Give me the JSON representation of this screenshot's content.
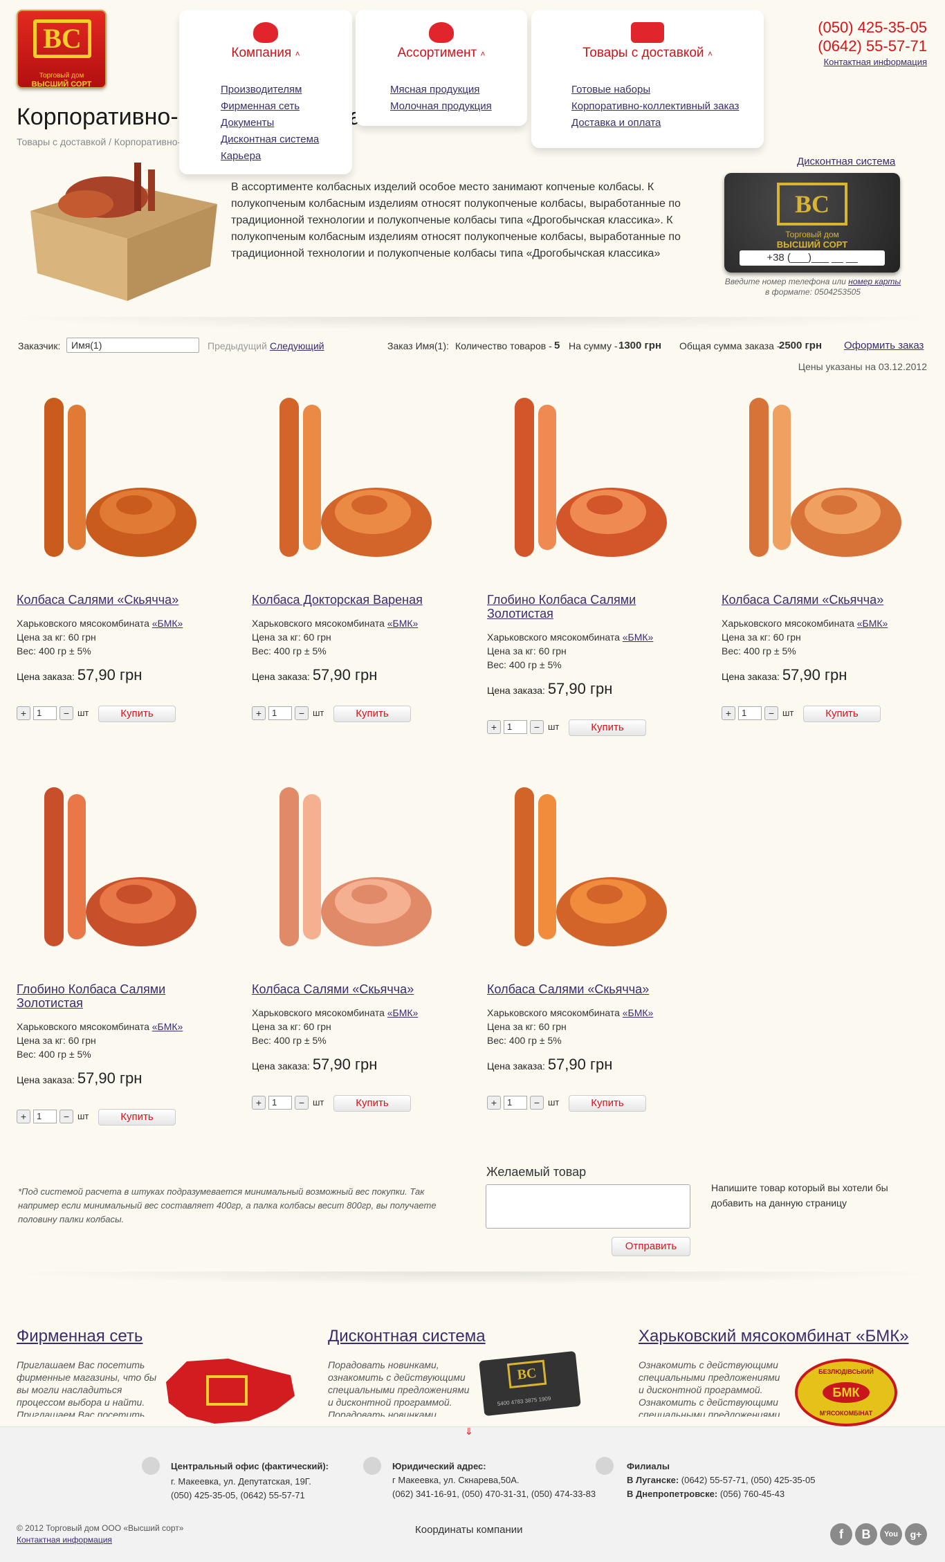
{
  "logo": {
    "mark": "ВС",
    "line1": "Торговый дом",
    "line2": "ВЫСШИЙ СОРТ"
  },
  "nav": [
    {
      "title": "Компания",
      "items": [
        "Производителям",
        "Фирменная сеть",
        "Документы",
        "Дисконтная система",
        "Карьера"
      ]
    },
    {
      "title": "Ассортимент",
      "items": [
        "Мясная продукция",
        "Молочная продукция"
      ]
    },
    {
      "title": "Товары с доставкой",
      "items": [
        "Готовые наборы",
        "Корпоративно-коллективный заказ",
        "Доставка и оплата"
      ]
    }
  ],
  "phones": {
    "p1": "(050) 425-35-05",
    "p2": "(0642) 55-57-71",
    "contact": "Контактная информация"
  },
  "page": {
    "title": "Корпоративно-коллективный заказ",
    "breadcrumb": "Товары с доставкой / Корпоративно-коллективный заказ"
  },
  "intro": {
    "text": "В ассортименте колбасных изделий особое место занимают копченые колбасы. К полукопченым колбасным изделиям относят полукопченые колбасы, выработанные по традиционной технологии и полукопченые колбасы типа «Дрогобычская классика». К полукопченым колбасным изделиям относят полукопченые колбасы, выработанные по традиционной технологии и полукопченые колбасы типа «Дрогобычская классика»"
  },
  "discount": {
    "link": "Дисконтная система",
    "card_line1": "Торговый дом",
    "card_line2": "ВЫСШИЙ СОРТ",
    "phone_mask": "+38 (___)___ __ __",
    "hint1": "Введите номер телефона или ",
    "hint_link": "номер карты",
    "hint2": "в формате: 0504253505"
  },
  "order": {
    "customer_label": "Заказчик:",
    "customer_value": "Имя(1)",
    "prev": "Предыдущий",
    "next": "Следующий",
    "order_name": "Заказ Имя(1):",
    "count_label": "Количество товаров -",
    "count": "5",
    "sum_label": "На сумму -",
    "sum": "1300 грн",
    "total_label": "Общая сумма заказа -",
    "total": "2500 грн",
    "checkout": "Оформить заказ",
    "prices_date": "Цены указаны на 03.12.2012"
  },
  "products": [
    {
      "name": "Колбаса Салями «Скьяччa»",
      "origin": "Харьковского мясокомбината ",
      "brand": "«БМК»",
      "price_kg": "Цена за кг: 60 грн",
      "weight": "Вес: 400 гр ± 5%",
      "order_label": "Цена заказа:",
      "order_price": "57,90 грн",
      "qty": "1",
      "unit": "шт",
      "buy": "Купить",
      "colors": [
        "#c95b1c",
        "#e07a34"
      ]
    },
    {
      "name": "Колбаса Докторская Вареная",
      "origin": "Харьковского мясокомбината ",
      "brand": "«БМК»",
      "price_kg": "Цена за кг: 60 грн",
      "weight": "Вес: 400 гр ± 5%",
      "order_label": "Цена заказа:",
      "order_price": "57,90 грн",
      "qty": "1",
      "unit": "шт",
      "buy": "Купить",
      "colors": [
        "#d3642a",
        "#eb8a45"
      ]
    },
    {
      "name": "Глобино Колбаса Салями Золотистая",
      "origin": "Харьковского мясокомбината ",
      "brand": "«БМК»",
      "price_kg": "Цена за кг: 60 грн",
      "weight": "Вес: 400 гр ± 5%",
      "order_label": "Цена заказа:",
      "order_price": "57,90 грн",
      "qty": "1",
      "unit": "шт",
      "buy": "Купить",
      "colors": [
        "#d2562a",
        "#ef8a52"
      ]
    },
    {
      "name": "Колбаса Салями «Скьяччa»",
      "origin": "Харьковского мясокомбината ",
      "brand": "«БМК»",
      "price_kg": "Цена за кг: 60 грн",
      "weight": "Вес: 400 гр ± 5%",
      "order_label": "Цена заказа:",
      "order_price": "57,90 грн",
      "qty": "1",
      "unit": "шт",
      "buy": "Купить",
      "colors": [
        "#d77338",
        "#f0a060"
      ]
    },
    {
      "name": "Глобино Колбаса Салями Золотистая",
      "origin": "Харьковского мясокомбината ",
      "brand": "«БМК»",
      "price_kg": "Цена за кг: 60 грн",
      "weight": "Вес: 400 гр ± 5%",
      "order_label": "Цена заказа:",
      "order_price": "57,90 грн",
      "qty": "1",
      "unit": "шт",
      "buy": "Купить",
      "colors": [
        "#c7502a",
        "#e87848"
      ]
    },
    {
      "name": "Колбаса Салями «Скьяччa»",
      "origin": "Харьковского мясокомбината ",
      "brand": "«БМК»",
      "price_kg": "Цена за кг: 60 грн",
      "weight": "Вес: 400 гр ± 5%",
      "order_label": "Цена заказа:",
      "order_price": "57,90 грн",
      "qty": "1",
      "unit": "шт",
      "buy": "Купить",
      "colors": [
        "#e08a68",
        "#f4b090"
      ]
    },
    {
      "name": "Колбаса Салями «Скьяччa»",
      "origin": "Харьковского мясокомбината ",
      "brand": "«БМК»",
      "price_kg": "Цена за кг: 60 грн",
      "weight": "Вес: 400 гр ± 5%",
      "order_label": "Цена заказа:",
      "order_price": "57,90 грн",
      "qty": "1",
      "unit": "шт",
      "buy": "Купить",
      "colors": [
        "#d2642a",
        "#f08c3c"
      ]
    }
  ],
  "note": "*Под системой расчета в штуках подразумевается минимальный возможный вес покупки. Так например если минимальный вес составляет 400гр, а палка колбасы весит 800гр, вы получаете половину палки колбасы.",
  "wish": {
    "title": "Желаемый товар",
    "hint": "Напишите товар который вы хотели бы добавить  на данную страницу",
    "send": "Отправить"
  },
  "bottom": [
    {
      "title": "Фирменная сеть",
      "text": "Приглашаем Вас посетить фирменные магазины, что бы вы могли насладиться процессом выбора и найти. Приглашаем Вас посетить фирменные магазины"
    },
    {
      "title": "Дисконтная система",
      "text": "Порадовать новинками, ознакомить с действующими специальными предложениями и дисконтной программой. Порадовать новинками, ознакомить с действующими",
      "card_number": "5400 4783 3875 1909"
    },
    {
      "title": "Харьковский мясокомбинат «БМК»",
      "text": "Ознакомить с действующими специальными предложениями и дисконтной программой. Ознакомить с действующими специальными предложениями и дисконтной программой.",
      "seal_top": "БЕЗЛЮДІВСЬКИЙ",
      "seal_mid": "БМК",
      "seal_bottom": "М'ЯСОКОМБІНАТ"
    }
  ],
  "footer": {
    "office_title": "Центральный офис (фактический):",
    "office_l1": "г. Макеевка, ул. Депутатская, 19Г.",
    "office_l2": "(050) 425-35-05, (0642) 55-57-71",
    "legal_title": "Юридический адрес:",
    "legal_l1": "г Макеевка, ул. Скнарева,50А.",
    "legal_l2": "(062) 341-16-91, (050) 470-31-31, (050) 474-33-83",
    "branch_title": "Филиалы",
    "branch_l1_city": "В Луганске:",
    "branch_l1": " (0642) 55-57-71, (050) 425-35-05",
    "branch_l2_city": "В Днепропетровске:",
    "branch_l2": " (056) 760-45-43",
    "copyright": "© 2012 Торговый дом ООО «Высший сорт»",
    "contact": "Контактная информация",
    "coords": "Координаты компании",
    "social": [
      "f",
      "B",
      "You",
      "g+"
    ]
  }
}
